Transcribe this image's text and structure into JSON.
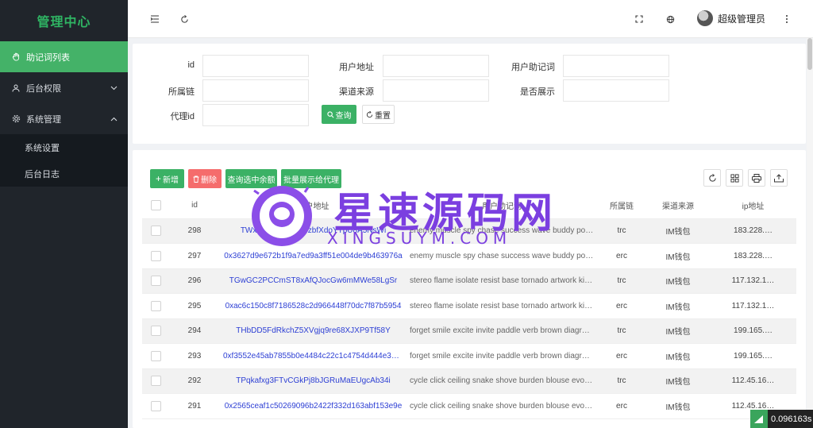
{
  "sidebar": {
    "logo": "管理中心",
    "items": [
      {
        "label": "助记词列表",
        "icon": "hand-icon",
        "active": true
      },
      {
        "label": "后台权限",
        "icon": "user-icon"
      },
      {
        "label": "系统管理",
        "icon": "gear-icon"
      }
    ],
    "submenu": [
      {
        "label": "系统设置"
      },
      {
        "label": "后台日志"
      }
    ]
  },
  "header": {
    "user_name": "超级管理员"
  },
  "search": {
    "fields": [
      {
        "label": "id",
        "value": ""
      },
      {
        "label": "用户地址",
        "value": ""
      },
      {
        "label": "用户助记词",
        "value": ""
      },
      {
        "label": "所属链",
        "value": ""
      },
      {
        "label": "渠道来源",
        "value": ""
      },
      {
        "label": "是否展示",
        "value": ""
      },
      {
        "label": "代理id",
        "value": ""
      }
    ],
    "query_label": "查询",
    "reset_label": "重置"
  },
  "toolbar": {
    "add_label": "新增",
    "delete_label": "删除",
    "query_balance_label": "查询选中余额",
    "batch_label": "批量展示给代理"
  },
  "table": {
    "headers": [
      "id",
      "用户地址",
      "用户助记词",
      "所属链",
      "渠道来源",
      "ip地址"
    ],
    "rows": [
      {
        "id": "298",
        "addr": "TWxxxxxxxxxxZEPzbfXdoYTpU8A5NsWi",
        "mnem": "enemy muscle spy chase success wave buddy pover…",
        "chain": "trc",
        "source": "IM钱包",
        "ip": "183.228.…"
      },
      {
        "id": "297",
        "addr": "0x3627d9e672b1f9a7ed9a3ff51e004de9b463976a",
        "mnem": "enemy muscle spy chase success wave buddy pover…",
        "chain": "erc",
        "source": "IM钱包",
        "ip": "183.228.…"
      },
      {
        "id": "296",
        "addr": "TGwGC2PCCmST8xAfQJocGw6mMWe58LgSr",
        "mnem": "stereo flame isolate resist base tornado artwork kiss …",
        "chain": "trc",
        "source": "IM钱包",
        "ip": "117.132.1…"
      },
      {
        "id": "295",
        "addr": "0xac6c150c8f7186528c2d966448f70dc7f87b5954",
        "mnem": "stereo flame isolate resist base tornado artwork kiss …",
        "chain": "erc",
        "source": "IM钱包",
        "ip": "117.132.1…"
      },
      {
        "id": "294",
        "addr": "THbDD5FdRkchZ5XVgjq9re68XJXP9Tf58Y",
        "mnem": "forget smile excite invite paddle verb brown diagram …",
        "chain": "trc",
        "source": "IM钱包",
        "ip": "199.165.…"
      },
      {
        "id": "293",
        "addr": "0xf3552e45ab7855b0e4484c22c1c4754d444e3ee0",
        "mnem": "forget smile excite invite paddle verb brown diagram …",
        "chain": "erc",
        "source": "IM钱包",
        "ip": "199.165.…"
      },
      {
        "id": "292",
        "addr": "TPqkafxg3FTvCGkPj8bJGRuMaEUgcAb34i",
        "mnem": "cycle click ceiling snake shove burden blouse evolve …",
        "chain": "trc",
        "source": "IM钱包",
        "ip": "112.45.16…"
      },
      {
        "id": "291",
        "addr": "0x2565ceaf1c50269096b2422f332d163abf153e9e",
        "mnem": "cycle click ceiling snake shove burden blouse evolve …",
        "chain": "erc",
        "source": "IM钱包",
        "ip": "112.45.16…"
      }
    ]
  },
  "watermark": {
    "title": "星速源码网",
    "subtitle": "XINGSUYM.COM"
  },
  "timer": {
    "value": "0.096163s"
  },
  "colors": {
    "accent": "#3bb165",
    "sidebar_bg": "#20252b",
    "danger": "#f56c6c",
    "link": "#2d3fd4",
    "watermark": "#7b3fe0"
  }
}
